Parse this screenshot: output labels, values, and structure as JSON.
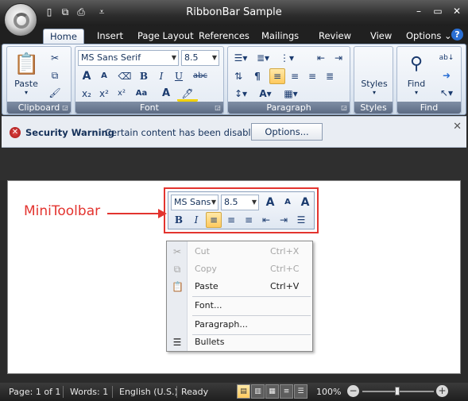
{
  "window": {
    "title": "RibbonBar Sample",
    "controls": {
      "minimize": "–",
      "maximize": "▭",
      "close": "✕"
    }
  },
  "quick_access": [
    "new-icon",
    "copy-icon",
    "print-icon",
    "customize-arrow-icon"
  ],
  "tabs": [
    {
      "label": "Home",
      "active": true
    },
    {
      "label": "Insert"
    },
    {
      "label": "Page Layout"
    },
    {
      "label": "References"
    },
    {
      "label": "Mailings"
    },
    {
      "label": "Review"
    },
    {
      "label": "View"
    }
  ],
  "options_menu": "Options",
  "help_glyph": "?",
  "ribbon": {
    "clipboard": {
      "group_label": "Clipboard",
      "paste_label": "Paste"
    },
    "font": {
      "group_label": "Font",
      "font_name": "MS Sans Serif",
      "font_size": "8.5",
      "grow_glyph": "A",
      "shrink_glyph": "A",
      "bold": "B",
      "italic": "I",
      "underline": "U",
      "strike": "abc",
      "sub": "x₂",
      "sup": "x²",
      "change_case": "Aa",
      "font_color": "A"
    },
    "paragraph": {
      "group_label": "Paragraph",
      "pilcrow": "¶"
    },
    "styles": {
      "group_label": "Styles",
      "label": "Styles"
    },
    "find": {
      "group_label": "Find",
      "label": "Find"
    }
  },
  "security_bar": {
    "title": "Security Warning",
    "message": "Certain content has been disabled.",
    "button": "Options...",
    "close": "✕"
  },
  "annotation": {
    "label": "MiniToolbar",
    "color": "#e3342f"
  },
  "minitoolbar": {
    "font_name": "MS Sans",
    "font_size": "8.5",
    "grow": "A",
    "shrink": "A",
    "styles": "A",
    "bold": "B",
    "italic": "I"
  },
  "context_menu": [
    {
      "label": "Cut",
      "shortcut": "Ctrl+X",
      "disabled": true,
      "icon": "✂"
    },
    {
      "label": "Copy",
      "shortcut": "Ctrl+C",
      "disabled": true,
      "icon": "⧉"
    },
    {
      "label": "Paste",
      "shortcut": "Ctrl+V",
      "disabled": false,
      "icon": "📋"
    },
    {
      "label": "Font...",
      "shortcut": "",
      "disabled": false,
      "icon": ""
    },
    {
      "label": "Paragraph...",
      "shortcut": "",
      "disabled": false,
      "icon": ""
    },
    {
      "label": "Bullets",
      "shortcut": "",
      "disabled": false,
      "icon": "☰"
    }
  ],
  "status_bar": {
    "page": "Page: 1 of 1",
    "words": "Words: 1",
    "language": "English (U.S.)",
    "state": "Ready",
    "zoom": "100%"
  }
}
